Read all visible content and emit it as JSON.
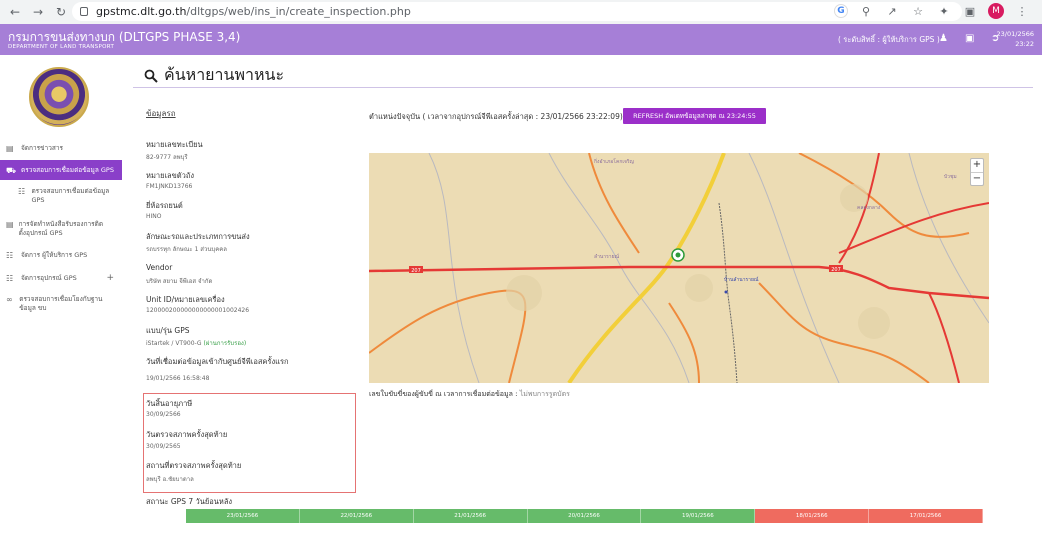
{
  "browser": {
    "url_host": "gpstmc.dlt.go.th",
    "url_path": "/dltgps/web/ins_in/create_inspection.php",
    "profile_initial": "M"
  },
  "header": {
    "title": "กรมการขนส่งทางบก (DLTGPS PHASE 3,4)",
    "subtitle": "DEPARTMENT OF LAND TRANSPORT",
    "role": "( ระดับสิทธิ์ : ผู้ให้บริการ GPS )",
    "date": "23/01/2566",
    "time": "23:22"
  },
  "sidebar": {
    "items": [
      {
        "label": "จัดการข่าวสาร",
        "icon": "newspaper-icon"
      },
      {
        "label": "ตรวจสอบการเชื่อมต่อข้อมูล GPS",
        "icon": "truck-icon",
        "active": true
      },
      {
        "label": "ตรวจสอบการเชื่อมต่อข้อมูล GPS",
        "icon": "sitemap-icon",
        "sub": true
      },
      {
        "label": "การจัดทำหนังสือรับรองการติดตั้งอุปกรณ์ GPS",
        "icon": "document-icon"
      },
      {
        "label": "จัดการ ผู้ให้บริการ GPS",
        "icon": "sitemap-icon"
      },
      {
        "label": "จัดการอุปกรณ์ GPS",
        "icon": "sitemap-icon",
        "plus": "+"
      },
      {
        "label": "ตรวจสอบการเชื่อมโยงกับฐานข้อมูล ขบ",
        "icon": "link-icon"
      }
    ]
  },
  "page": {
    "title": "ค้นหายานพาหนะ"
  },
  "vehicle": {
    "heading": "ข้อมูลรถ",
    "fields": [
      {
        "label": "หมายเลขทะเบียน",
        "value": "82-9777 ลพบุรี"
      },
      {
        "label": "หมายเลขตัวถัง",
        "value": "FM1JNKD13766"
      },
      {
        "label": "ยี่ห้อรถยนต์",
        "value": "HINO"
      },
      {
        "label": "ลักษณะรถและประเภทการขนส่ง",
        "value": "รถบรรทุก ลักษณะ 1 ส่วนบุคคล"
      },
      {
        "label": "Vendor",
        "value": "บริษัท สยาม จีพีเอส จำกัด"
      },
      {
        "label": "Unit ID/หมายเลขเครื่อง",
        "value": "120000200000000000001002426"
      },
      {
        "label": "แบบ/รุ่น GPS",
        "value": "iStartek / VT900-G",
        "value_extra": "(ผ่านการรับรอง)"
      },
      {
        "label": "วันที่เชื่อมต่อข้อมูลเข้ากับศูนย์จีพีเอสครั้งแรก",
        "value": "19/01/2566 16:58:48"
      },
      {
        "label": "วันสิ้นอายุภาษี",
        "value": "30/09/2566"
      },
      {
        "label": "วันตรวจสภาพครั้งสุดท้าย",
        "value": "30/09/2565"
      },
      {
        "label": "สถานที่ตรวจสภาพครั้งสุดท้าย",
        "value": "ลพบุรี อ.ชัยบาดาล"
      }
    ]
  },
  "position": {
    "text": "ตำแหน่งปัจจุบัน ( เวลาจากอุปกรณ์จีพีเอสครั้งล่าสุด : 23/01/2566 23:22:09)",
    "refresh_label": "REFRESH อัพเดทข้อมูลล่าสุด ณ 23:24:55"
  },
  "map": {
    "zoom_in": "+",
    "zoom_out": "−",
    "labels": [
      "207",
      "207",
      "กิ่งอำเภอโคกเจริญ",
      "คลองกลาง",
      "บ้านลำนารายณ์",
      "ลำนารายณ์",
      "บัวชุม"
    ]
  },
  "driver": {
    "prefix": "เลขใบขับขี่ของผู้ขับขี่ ณ เวลาการเชื่อมต่อข้อมูล :",
    "value": "ไม่พบการรูดบัตร"
  },
  "status": {
    "label": "สถานะ GPS 7 วันย้อนหลัง",
    "days": [
      {
        "date": "23/01/2566",
        "state": "ok"
      },
      {
        "date": "22/01/2566",
        "state": "ok"
      },
      {
        "date": "21/01/2566",
        "state": "ok"
      },
      {
        "date": "20/01/2566",
        "state": "ok"
      },
      {
        "date": "19/01/2566",
        "state": "ok"
      },
      {
        "date": "18/01/2566",
        "state": "bad"
      },
      {
        "date": "17/01/2566",
        "state": "bad"
      }
    ],
    "colors": {
      "ok": "#66bb6a",
      "bad": "#ef6b5f"
    }
  }
}
